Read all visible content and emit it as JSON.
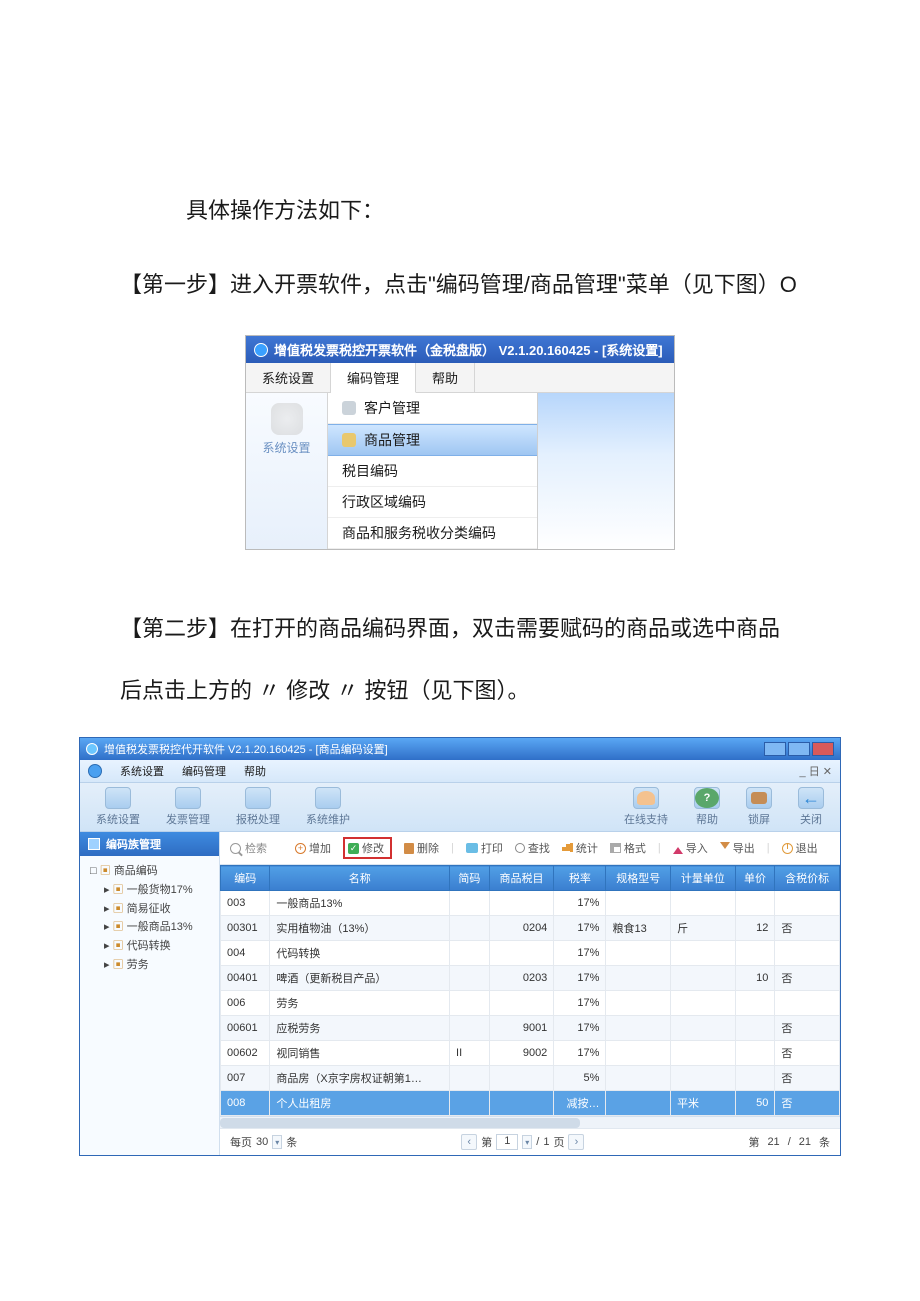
{
  "narration": {
    "intro": "具体操作方法如下：",
    "step1": "【第一步】进入开票软件，点击\"编码管理/商品管理\"菜单（见下图）O",
    "step2": "【第二步】在打开的商品编码界面，双击需要赋码的商品或选中商品后点击上方的 〃 修改 〃 按钮（见下图）。"
  },
  "screenshot1": {
    "title": "增值税发票税控开票软件（金税盘版） V2.1.20.160425 - [系统设置]",
    "tabs": {
      "a": "系统设置",
      "b": "编码管理",
      "c": "帮助"
    },
    "left_label": "系统设置",
    "menu": {
      "customer": "客户管理",
      "product": "商品管理",
      "taxitem": "税目编码",
      "region": "行政区域编码",
      "taxclass": "商品和服务税收分类编码"
    }
  },
  "screenshot2": {
    "title": "增值税发票税控代开软件 V2.1.20.160425 - [商品编码设置]",
    "menubar": {
      "a": "系统设置",
      "b": "编码管理",
      "c": "帮助",
      "right": "_ 日 ✕"
    },
    "bigtools": {
      "sys": "系统设置",
      "inv": "发票管理",
      "tax": "报税处理",
      "maint": "系统维护",
      "online": "在线支持",
      "help": "帮助",
      "lock": "锁屏",
      "close": "关闭"
    },
    "side_header": "编码族管理",
    "tree": {
      "root": "商品编码",
      "n1": "一般货物17%",
      "n2": "简易征收",
      "n3": "一般商品13%",
      "n4": "代码转换",
      "n5": "劳务"
    },
    "toolbar": {
      "search": "检索",
      "add": "增加",
      "modify": "修改",
      "del": "删除",
      "print": "打印",
      "find": "查找",
      "stat": "统计",
      "grid": "格式",
      "import": "导入",
      "export": "导出",
      "exit": "退出"
    },
    "columns": {
      "code": "编码",
      "name": "名称",
      "short": "简码",
      "taxitem": "商品税目",
      "rate": "税率",
      "spec": "规格型号",
      "unit": "计量单位",
      "price": "单价",
      "incl": "含税价标"
    },
    "rows": [
      {
        "code": "003",
        "name": "一般商品13%",
        "short": "",
        "taxitem": "",
        "rate": "17%",
        "spec": "",
        "unit": "",
        "price": "",
        "incl": ""
      },
      {
        "code": "00301",
        "name": "实用植物油（13%）",
        "short": "",
        "taxitem": "0204",
        "rate": "17%",
        "spec": "粮食13",
        "unit": "斤",
        "price": "12",
        "incl": "否"
      },
      {
        "code": "004",
        "name": "代码转换",
        "short": "",
        "taxitem": "",
        "rate": "17%",
        "spec": "",
        "unit": "",
        "price": "",
        "incl": ""
      },
      {
        "code": "00401",
        "name": "啤酒（更新税目产品）",
        "short": "",
        "taxitem": "0203",
        "rate": "17%",
        "spec": "",
        "unit": "",
        "price": "10",
        "incl": "否"
      },
      {
        "code": "006",
        "name": "劳务",
        "short": "",
        "taxitem": "",
        "rate": "17%",
        "spec": "",
        "unit": "",
        "price": "",
        "incl": ""
      },
      {
        "code": "00601",
        "name": "应税劳务",
        "short": "",
        "taxitem": "9001",
        "rate": "17%",
        "spec": "",
        "unit": "",
        "price": "",
        "incl": "否"
      },
      {
        "code": "00602",
        "name": "视同销售",
        "short": "II",
        "taxitem": "9002",
        "rate": "17%",
        "spec": "",
        "unit": "",
        "price": "",
        "incl": "否"
      },
      {
        "code": "007",
        "name": "商品房（X京字房权证朝第1…",
        "short": "",
        "taxitem": "",
        "rate": "5%",
        "spec": "",
        "unit": "",
        "price": "",
        "incl": "否"
      },
      {
        "code": "008",
        "name": "个人出租房",
        "short": "",
        "taxitem": "",
        "rate": "减按…",
        "spec": "",
        "unit": "平米",
        "price": "50",
        "incl": "否"
      }
    ],
    "pager": {
      "per_page_label": "每页",
      "per_page": "30",
      "unit": "条",
      "page_word": "第",
      "page_no": "1",
      "sep": "/",
      "total_pages": "1",
      "page_suffix": "页",
      "right_page_word": "第",
      "right_cur": "21",
      "right_sep": "/",
      "right_total": "21",
      "right_unit": "条"
    }
  }
}
